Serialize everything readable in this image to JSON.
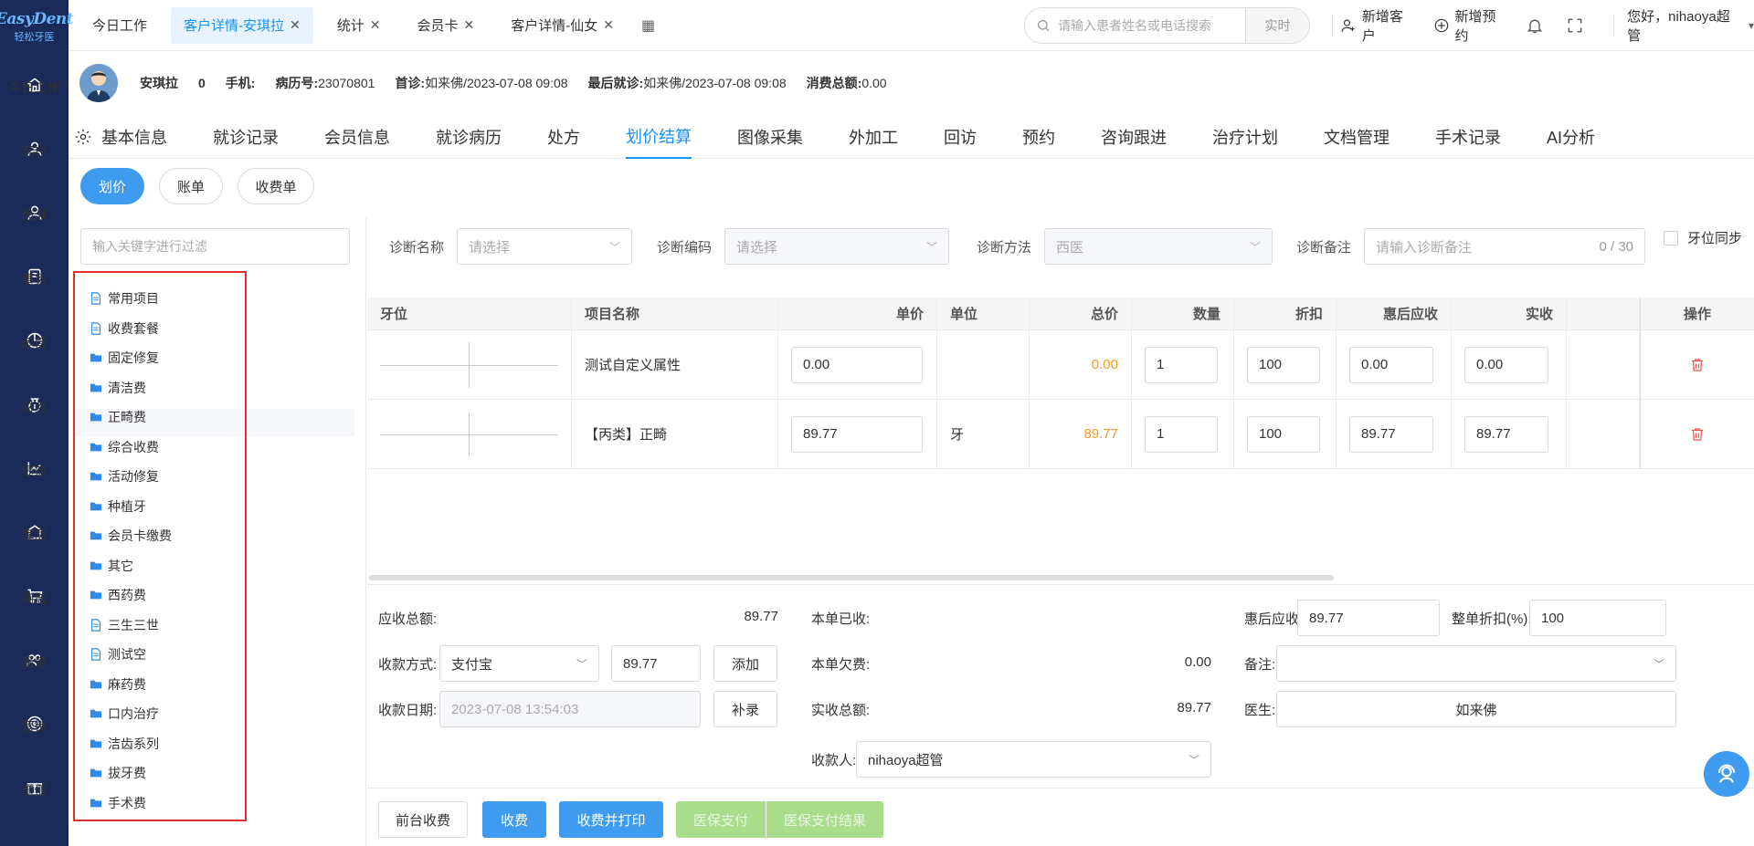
{
  "brand": {
    "logo_text": "EasyDent",
    "logo_sub": "轻松牙医"
  },
  "sidebar": {
    "items": [
      {
        "label": "今日工作",
        "icon": "home-icon"
      },
      {
        "label": "客户",
        "icon": "user-icon"
      },
      {
        "label": "齿湃",
        "icon": "user-star-icon"
      },
      {
        "label": "事务",
        "icon": "task-icon"
      },
      {
        "label": "运营",
        "icon": "pie-chart-icon"
      },
      {
        "label": "财务",
        "icon": "money-bag-icon"
      },
      {
        "label": "绩效",
        "icon": "line-chart-icon"
      },
      {
        "label": "库房",
        "icon": "warehouse-icon"
      },
      {
        "label": "商城",
        "icon": "cart-icon"
      },
      {
        "label": "医患",
        "icon": "doctor-patient-icon"
      },
      {
        "label": "营销",
        "icon": "target-icon"
      },
      {
        "label": "增值",
        "icon": "gift-icon"
      }
    ]
  },
  "tabs": [
    {
      "label": "今日工作",
      "closable": false
    },
    {
      "label": "客户详情-安琪拉",
      "closable": true,
      "active": true
    },
    {
      "label": "统计",
      "closable": true
    },
    {
      "label": "会员卡",
      "closable": true
    },
    {
      "label": "客户详情-仙女",
      "closable": true
    }
  ],
  "search": {
    "placeholder": "请输入患者姓名或电话搜索",
    "mode": "实时"
  },
  "top_actions": {
    "new_customer": "新增客户",
    "new_appointment": "新增预约",
    "greeting": "您好，nihaoya超管"
  },
  "patient": {
    "name": "安琪拉",
    "age": "0",
    "phone_label": "手机:",
    "record_label": "病历号:",
    "record_no": "23070801",
    "first_visit_label": "首诊:",
    "first_visit": "如来佛/2023-07-08 09:08",
    "last_visit_label": "最后就诊:",
    "last_visit": "如来佛/2023-07-08 09:08",
    "total_label": "消费总额:",
    "total": "0.00"
  },
  "nav_tabs": [
    "基本信息",
    "就诊记录",
    "会员信息",
    "就诊病历",
    "处方",
    "划价结算",
    "图像采集",
    "外加工",
    "回访",
    "预约",
    "咨询跟进",
    "治疗计划",
    "文档管理",
    "手术记录",
    "AI分析"
  ],
  "sub_buttons": [
    "划价",
    "账单",
    "收费单"
  ],
  "filter_placeholder": "输入关键字进行过滤",
  "tree": [
    {
      "label": "常用项目",
      "type": "doc"
    },
    {
      "label": "收费套餐",
      "type": "doc"
    },
    {
      "label": "固定修复",
      "type": "folder"
    },
    {
      "label": "清洁费",
      "type": "folder"
    },
    {
      "label": "正畸费",
      "type": "folder"
    },
    {
      "label": "综合收费",
      "type": "folder"
    },
    {
      "label": "活动修复",
      "type": "folder"
    },
    {
      "label": "种植牙",
      "type": "folder"
    },
    {
      "label": "会员卡缴费",
      "type": "folder"
    },
    {
      "label": "其它",
      "type": "folder"
    },
    {
      "label": "西药费",
      "type": "folder"
    },
    {
      "label": "三生三世",
      "type": "doc"
    },
    {
      "label": "测试空",
      "type": "doc"
    },
    {
      "label": "麻药费",
      "type": "folder"
    },
    {
      "label": "口内治疗",
      "type": "folder"
    },
    {
      "label": "洁齿系列",
      "type": "folder"
    },
    {
      "label": "拔牙费",
      "type": "folder"
    },
    {
      "label": "手术费",
      "type": "folder"
    }
  ],
  "diag": {
    "name_label": "诊断名称",
    "name_placeholder": "请选择",
    "code_label": "诊断编码",
    "code_placeholder": "请选择",
    "method_label": "诊断方法",
    "method_value": "西医",
    "remark_label": "诊断备注",
    "remark_placeholder": "请输入诊断备注",
    "remark_count": "0 / 30",
    "sync_label": "牙位同步"
  },
  "table": {
    "headers": [
      "牙位",
      "项目名称",
      "单价",
      "单位",
      "总价",
      "数量",
      "折扣",
      "惠后应收",
      "实收",
      "操作"
    ],
    "rows": [
      {
        "name": "测试自定义属性",
        "price": "0.00",
        "unit": "",
        "total": "0.00",
        "qty": "1",
        "discount": "100",
        "after": "0.00",
        "paid": "0.00"
      },
      {
        "name": "【丙类】正畸",
        "price": "89.77",
        "unit": "牙",
        "total": "89.77",
        "qty": "1",
        "discount": "100",
        "after": "89.77",
        "paid": "89.77"
      }
    ]
  },
  "summary": {
    "receivable_label": "应收总额:",
    "receivable": "89.77",
    "method_label": "收款方式:",
    "method": "支付宝",
    "method_amount": "89.77",
    "add_btn": "添加",
    "date_label": "收款日期:",
    "date": "2023-07-08 13:54:03",
    "backfill_btn": "补录",
    "received_label": "本单已收:",
    "received": "",
    "owed_label": "本单欠费:",
    "owed": "0.00",
    "actual_label": "实收总额:",
    "actual": "89.77",
    "payee_label": "收款人:",
    "payee": "nihaoya超管",
    "after_label": "惠后应收:",
    "after": "89.77",
    "whole_discount_label": "整单折扣(%):",
    "whole_discount": "100",
    "remark_label": "备注:",
    "remark": "",
    "doctor_label": "医生:",
    "doctor": "如来佛"
  },
  "bottom_buttons": {
    "front": "前台收费",
    "charge": "收费",
    "charge_print": "收费并打印",
    "insurance": "医保支付",
    "insurance_result": "医保支付结果"
  },
  "colors": {
    "primary": "#1890ff",
    "sidebar": "#1a2b5a",
    "danger": "#f05050",
    "highlight": "#e03030"
  }
}
